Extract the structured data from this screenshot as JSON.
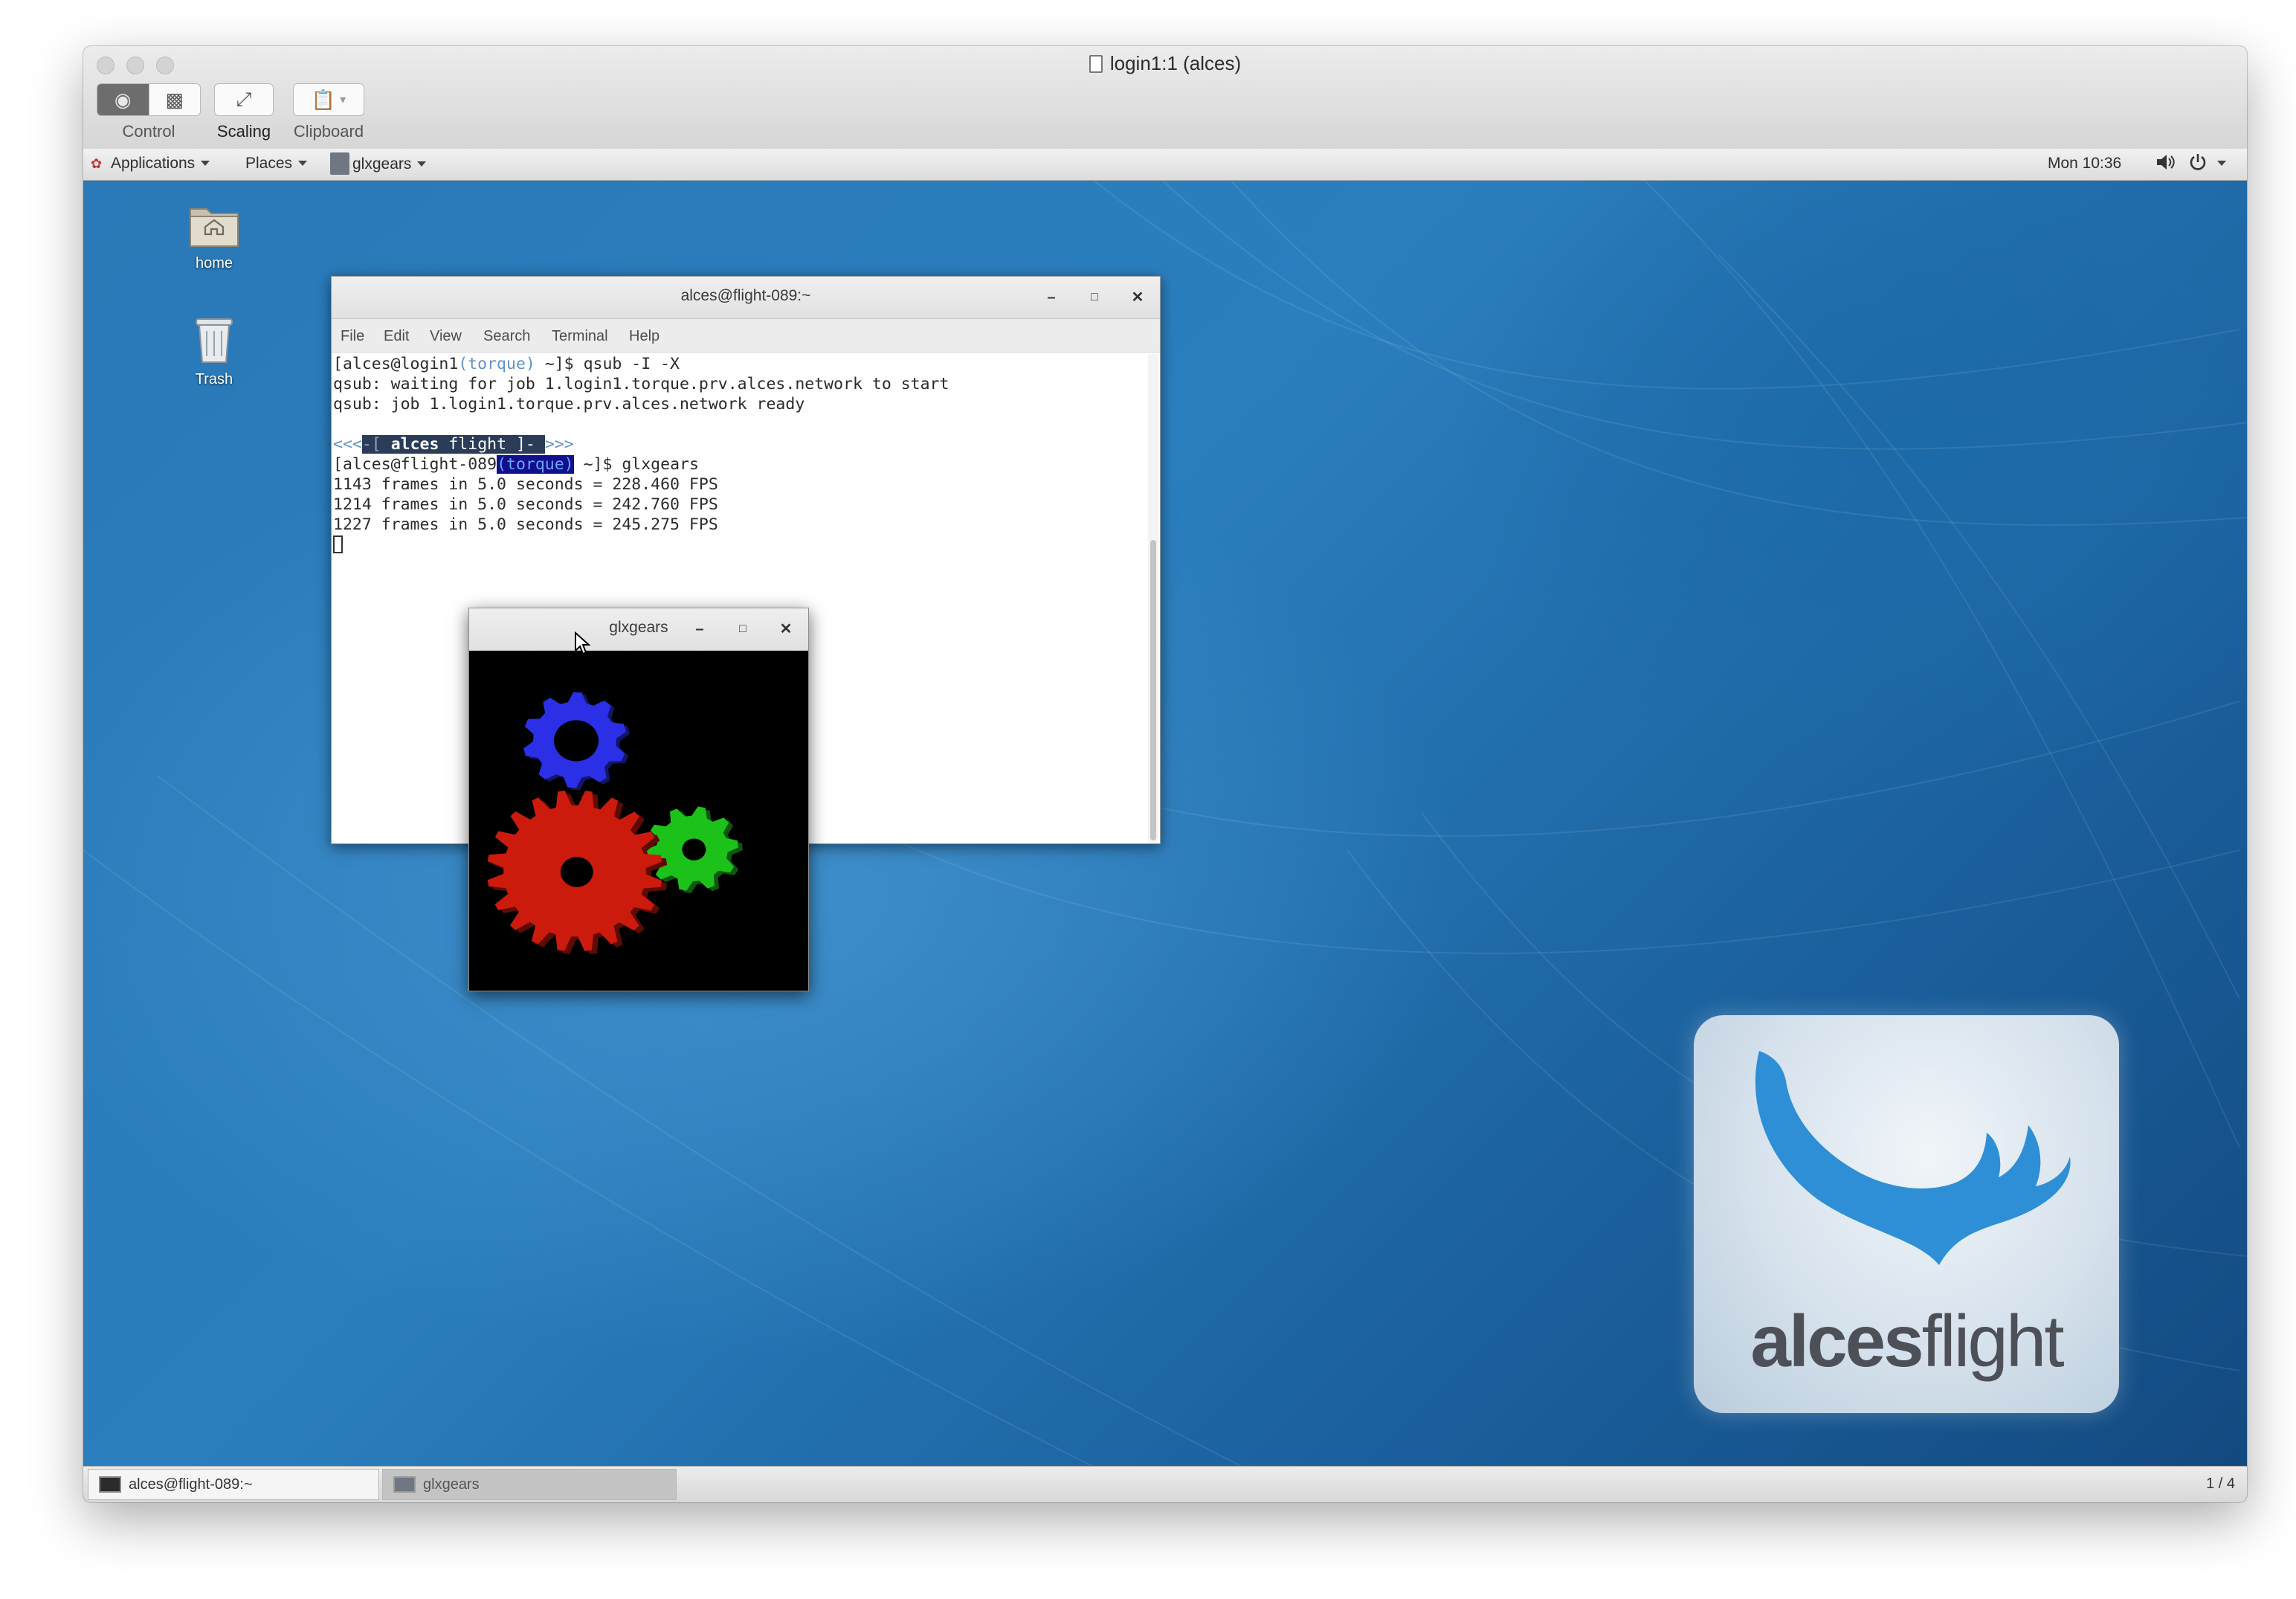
{
  "window": {
    "title": "login1:1 (alces)"
  },
  "toolbar": {
    "control_label": "Control",
    "scaling_label": "Scaling",
    "clipboard_label": "Clipboard"
  },
  "panel": {
    "applications": "Applications",
    "places": "Places",
    "active_app": "glxgears",
    "clock": "Mon 10:36"
  },
  "desktop": {
    "icons": [
      {
        "label": "home"
      },
      {
        "label": "Trash"
      }
    ]
  },
  "terminal": {
    "title": "alces@flight-089:~",
    "menu": [
      "File",
      "Edit",
      "View",
      "Search",
      "Terminal",
      "Help"
    ],
    "line1": {
      "a": "[alces@login1",
      "b": "(torque)",
      "c": " ~]$ qsub -I -X"
    },
    "line2": "qsub: waiting for job 1.login1.torque.prv.alces.network to start",
    "line3": "qsub: job 1.login1.torque.prv.alces.network ready",
    "banner": {
      "left": "<<<",
      "open": "-[ ",
      "name": "alces",
      "product": " flight ]- ",
      "right": ">>>"
    },
    "line5": {
      "a": "[alces@flight-089",
      "b": "(torque)",
      "c": " ~]$ glxgears"
    },
    "fps_lines": [
      "1143 frames in 5.0 seconds = 228.460 FPS",
      "1214 frames in 5.0 seconds = 242.760 FPS",
      "1227 frames in 5.0 seconds = 245.275 FPS"
    ]
  },
  "glxgears": {
    "title": "glxgears",
    "gear_colors": {
      "red": "#cc1a0c",
      "green": "#1cc21a",
      "blue": "#2b30e6"
    }
  },
  "logo": {
    "word_bold": "alces",
    "word_light": "flight",
    "accent_color": "#2e8fd6"
  },
  "taskbar": {
    "tasks": [
      {
        "label": "alces@flight-089:~"
      },
      {
        "label": "glxgears"
      }
    ],
    "workspace": "1 / 4"
  }
}
